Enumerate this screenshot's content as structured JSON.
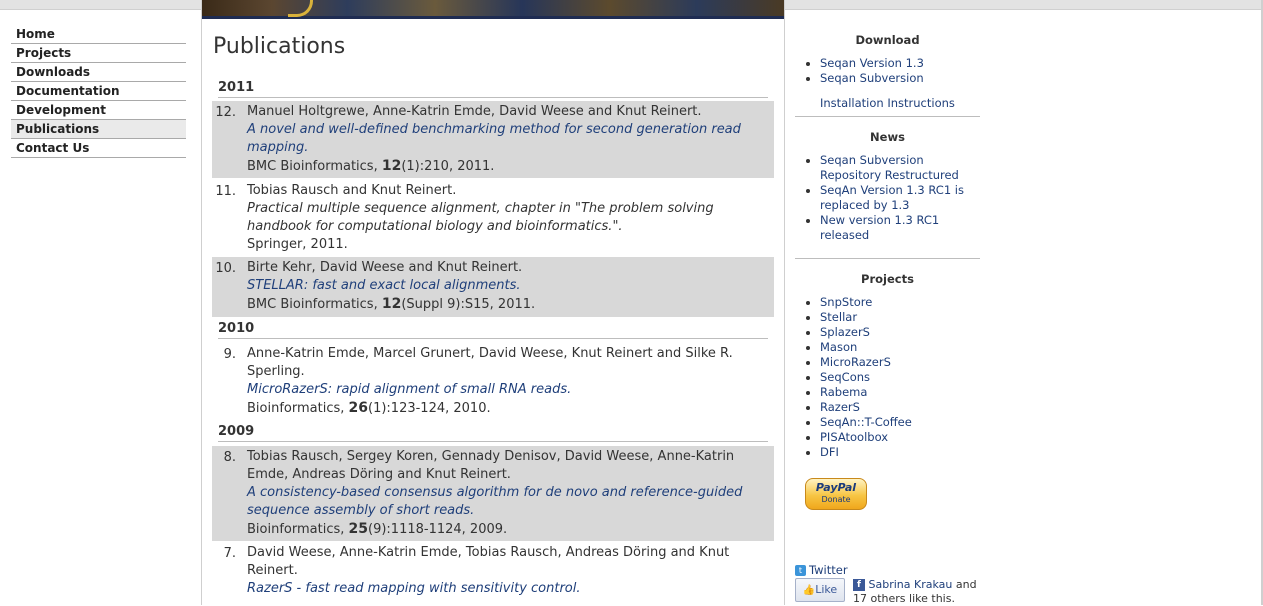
{
  "nav": {
    "items": [
      {
        "label": "Home"
      },
      {
        "label": "Projects"
      },
      {
        "label": "Downloads"
      },
      {
        "label": "Documentation"
      },
      {
        "label": "Development"
      },
      {
        "label": "Publications",
        "active": true
      },
      {
        "label": "Contact Us"
      }
    ]
  },
  "main": {
    "title": "Publications",
    "years": [
      "2011",
      "2010",
      "2009"
    ],
    "pubs": [
      {
        "num": "12.",
        "authors": "Manuel Holtgrewe, Anne-Katrin Emde, David Weese and Knut Reinert.",
        "title": "A novel and well-defined benchmarking method for second generation read mapping.",
        "venue_pre": "BMC Bioinformatics, ",
        "vol": "12",
        "venue_post": "(1):210, 2011."
      },
      {
        "num": "11.",
        "authors": "Tobias Rausch and Knut Reinert.",
        "title": "Practical multiple sequence alignment, chapter in \"The problem solving handbook for computational biology and bioinformatics.\".",
        "venue_pre": "Springer, 2011.",
        "vol": "",
        "venue_post": ""
      },
      {
        "num": "10.",
        "authors": "Birte Kehr, David Weese and Knut Reinert.",
        "title": "STELLAR: fast and exact local alignments.",
        "venue_pre": "BMC Bioinformatics, ",
        "vol": "12",
        "venue_post": "(Suppl 9):S15, 2011."
      },
      {
        "num": "9.",
        "authors": "Anne-Katrin Emde, Marcel Grunert, David Weese, Knut Reinert and Silke R. Sperling.",
        "title": "MicroRazerS: rapid alignment of small RNA reads.",
        "venue_pre": "Bioinformatics, ",
        "vol": "26",
        "venue_post": "(1):123-124, 2010."
      },
      {
        "num": "8.",
        "authors": "Tobias Rausch, Sergey Koren, Gennady Denisov, David Weese, Anne-Katrin Emde, Andreas Döring and Knut Reinert.",
        "title": "A consistency-based consensus algorithm for de novo and reference-guided sequence assembly of short reads.",
        "venue_pre": "Bioinformatics, ",
        "vol": "25",
        "venue_post": "(9):1118-1124, 2009."
      },
      {
        "num": "7.",
        "authors": "David Weese, Anne-Katrin Emde, Tobias Rausch, Andreas Döring and Knut Reinert.",
        "title": "RazerS - fast read mapping with sensitivity control.",
        "venue_pre": "",
        "vol": "",
        "venue_post": ""
      }
    ]
  },
  "sidebar": {
    "download_heading": "Download",
    "download_items": [
      "Seqan Version 1.3",
      "Seqan Subversion"
    ],
    "install_link": "Installation Instructions",
    "news_heading": "News",
    "news_items": [
      "Seqan Subversion Repository Restructured",
      "SeqAn Version 1.3 RC1 is replaced by 1.3",
      "New version 1.3 RC1 released"
    ],
    "projects_heading": "Projects",
    "project_items": [
      "SnpStore",
      "Stellar",
      "SplazerS",
      "Mason",
      "MicroRazerS",
      "SeqCons",
      "Rabema",
      "RazerS",
      "SeqAn::T-Coffee",
      "PISAtoolbox",
      "DFI"
    ],
    "paypal_logo": "PayPal",
    "paypal_label": "Donate",
    "twitter_label": "Twitter",
    "like_label": "Like",
    "like_name": "Sabrina Krakau",
    "like_rest": " and 17 others like this."
  }
}
